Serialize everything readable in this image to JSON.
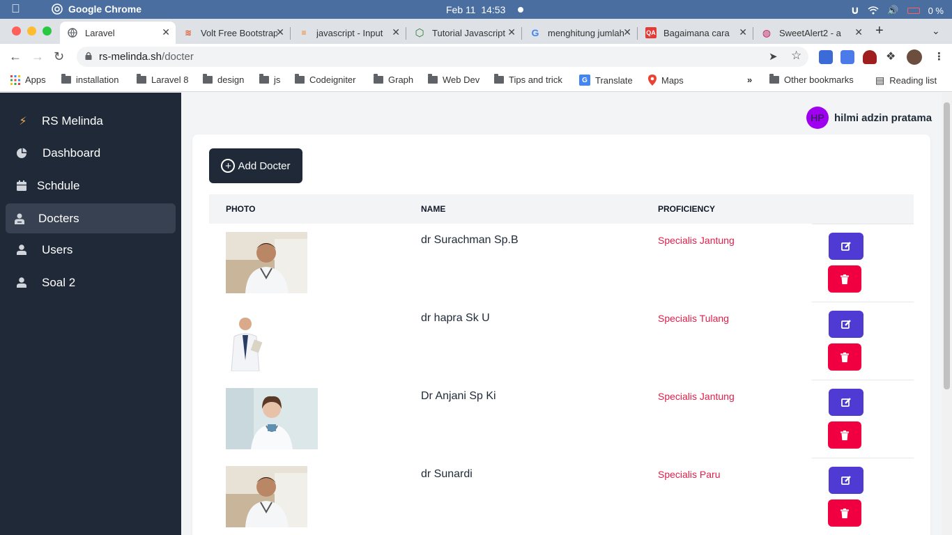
{
  "menubar": {
    "app_name": "Google Chrome",
    "date": "Feb 11",
    "time": "14:53",
    "battery": "0 %"
  },
  "tabs": [
    {
      "title": "Laravel",
      "favicon": "globe-icon",
      "active": true
    },
    {
      "title": "Volt Free Bootstrap",
      "favicon": "volt-icon"
    },
    {
      "title": "javascript - Input",
      "favicon": "stackoverflow-icon"
    },
    {
      "title": "Tutorial Javascript",
      "favicon": "hexagon-icon"
    },
    {
      "title": "menghitung jumlah",
      "favicon": "google-icon"
    },
    {
      "title": "Bagaimana cara",
      "favicon": "qa-icon"
    },
    {
      "title": "SweetAlert2 - a",
      "favicon": "sweetalert-icon"
    }
  ],
  "address": {
    "host": "rs-melinda.sh",
    "path": "/docter"
  },
  "bookmarks": {
    "apps": "Apps",
    "items": [
      "installation",
      "Laravel 8",
      "design",
      "js",
      "Codeigniter",
      "Graph",
      "Web Dev",
      "Tips and trick"
    ],
    "translate": "Translate",
    "maps": "Maps",
    "other": "Other bookmarks",
    "reading": "Reading list"
  },
  "sidebar": {
    "brand": "RS Melinda",
    "items": [
      {
        "label": "Dashboard",
        "icon": "pie-chart-icon"
      },
      {
        "label": "Schdule",
        "icon": "calendar-icon"
      },
      {
        "label": "Docters",
        "icon": "doctor-icon",
        "active": true
      },
      {
        "label": "Users",
        "icon": "user-icon"
      },
      {
        "label": "Soal 2",
        "icon": "user-icon"
      }
    ]
  },
  "user": {
    "initials": "HP",
    "name": "hilmi adzin pratama",
    "avatar_color": "#a000f0"
  },
  "main": {
    "add_label": "Add Docter",
    "columns": [
      "PHOTO",
      "NAME",
      "PROFICIENCY"
    ],
    "doctors": [
      {
        "name": "dr Surachman Sp.B",
        "proficiency": "Specialis Jantung"
      },
      {
        "name": "dr hapra Sk U",
        "proficiency": "Specialis Tulang"
      },
      {
        "name": "Dr Anjani Sp Ki",
        "proficiency": "Specialis Jantung"
      },
      {
        "name": "dr Sunardi",
        "proficiency": "Specialis Paru"
      }
    ]
  },
  "colors": {
    "sidebar_bg": "#1f2937",
    "edit_button": "#4f3ad4",
    "delete_button": "#f00040",
    "proficiency_text": "#e11d48"
  }
}
